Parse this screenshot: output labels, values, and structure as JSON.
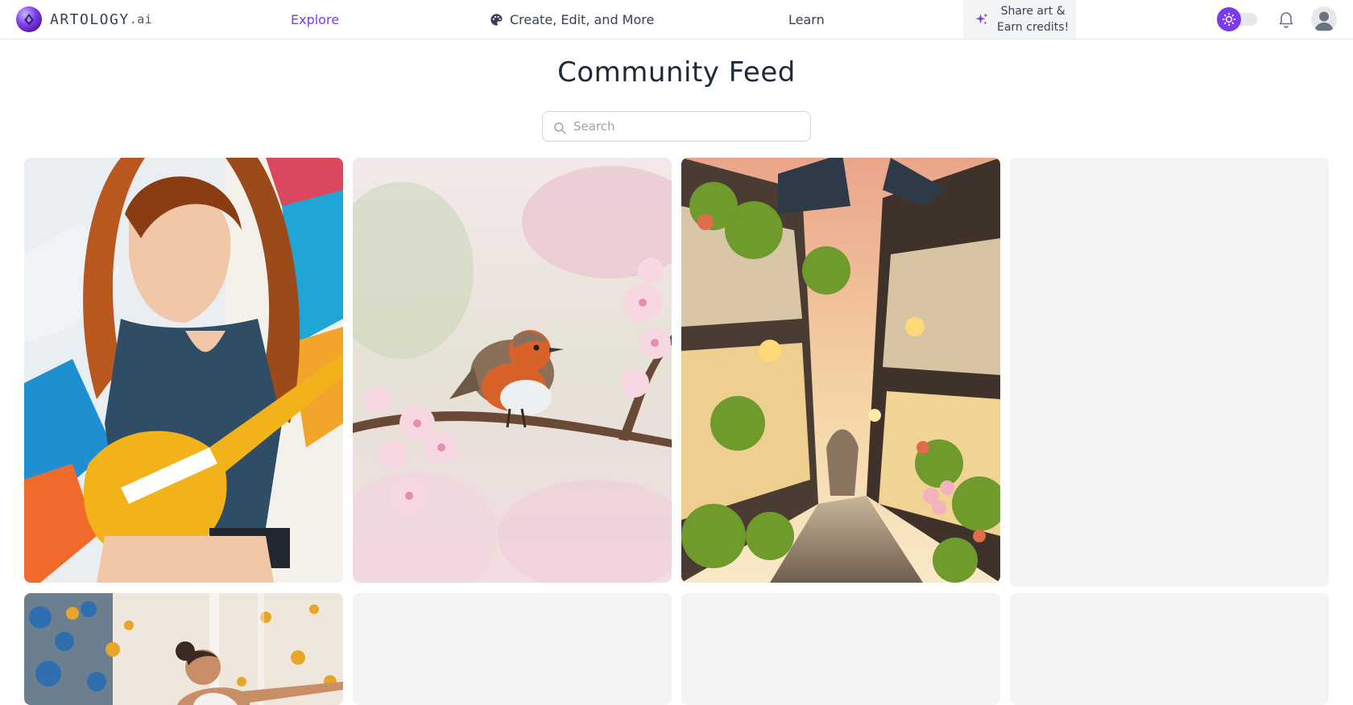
{
  "brand": {
    "name": "ARTOLOGY",
    "suffix": ".ai"
  },
  "nav": {
    "explore": "Explore",
    "create": "Create, Edit, and More",
    "learn": "Learn"
  },
  "share": {
    "line1": "Share art &",
    "line2": "Earn credits!"
  },
  "icons": {
    "logo": "logo-icon",
    "palette": "palette-icon",
    "sparkle": "sparkle-icon",
    "theme": "sun-icon",
    "bell": "bell-icon",
    "avatar": "user-icon",
    "search": "search-icon"
  },
  "colors": {
    "accent": "#7c3aed",
    "placeholder_bg": "#f3f4f6",
    "border": "#e5e7eb"
  },
  "page": {
    "title": "Community Feed"
  },
  "search": {
    "placeholder": "Search",
    "value": ""
  },
  "feed": {
    "items": [
      {
        "subject": "woman with electric guitar before graffiti wall",
        "loaded": true
      },
      {
        "subject": "robin perched on cherry blossom branch",
        "loaded": true
      },
      {
        "subject": "lantern-lit village alley at sunset",
        "loaded": true
      },
      {
        "subject": "",
        "loaded": false
      },
      {
        "subject": "dancer amid golden bokeh",
        "loaded": true
      },
      {
        "subject": "",
        "loaded": false
      },
      {
        "subject": "",
        "loaded": false
      },
      {
        "subject": "",
        "loaded": false
      }
    ]
  }
}
